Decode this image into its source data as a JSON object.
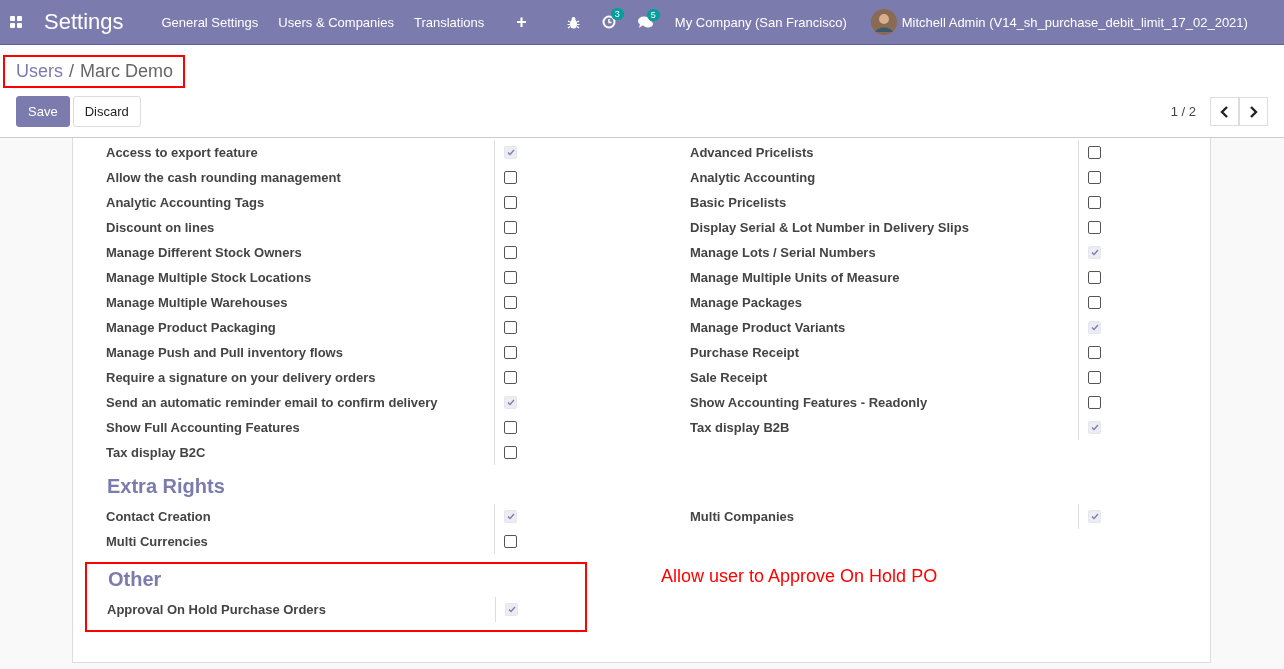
{
  "navbar": {
    "app_title": "Settings",
    "menu": [
      "General Settings",
      "Users & Companies",
      "Translations"
    ],
    "plus": "+",
    "activity_badge": "3",
    "message_badge": "5",
    "company": "My Company (San Francisco)",
    "user": "Mitchell Admin (V14_sh_purchase_debit_limit_17_02_2021)"
  },
  "breadcrumb": {
    "parent": "Users",
    "separator": "/",
    "current": "Marc Demo"
  },
  "buttons": {
    "save": "Save",
    "discard": "Discard"
  },
  "pager": {
    "text": "1 / 2"
  },
  "sections": [
    {
      "fields": [
        {
          "label": "Access to export feature",
          "checked": true
        },
        {
          "label": "Advanced Pricelists",
          "checked": false
        },
        {
          "label": "Allow the cash rounding management",
          "checked": false
        },
        {
          "label": "Analytic Accounting",
          "checked": false
        },
        {
          "label": "Analytic Accounting Tags",
          "checked": false
        },
        {
          "label": "Basic Pricelists",
          "checked": false
        },
        {
          "label": "Discount on lines",
          "checked": false
        },
        {
          "label": "Display Serial & Lot Number in Delivery Slips",
          "checked": false
        },
        {
          "label": "Manage Different Stock Owners",
          "checked": false
        },
        {
          "label": "Manage Lots / Serial Numbers",
          "checked": true
        },
        {
          "label": "Manage Multiple Stock Locations",
          "checked": false
        },
        {
          "label": "Manage Multiple Units of Measure",
          "checked": false
        },
        {
          "label": "Manage Multiple Warehouses",
          "checked": false
        },
        {
          "label": "Manage Packages",
          "checked": false
        },
        {
          "label": "Manage Product Packaging",
          "checked": false
        },
        {
          "label": "Manage Product Variants",
          "checked": true
        },
        {
          "label": "Manage Push and Pull inventory flows",
          "checked": false
        },
        {
          "label": "Purchase Receipt",
          "checked": false
        },
        {
          "label": "Require a signature on your delivery orders",
          "checked": false
        },
        {
          "label": "Sale Receipt",
          "checked": false
        },
        {
          "label": "Send an automatic reminder email to confirm delivery",
          "checked": true
        },
        {
          "label": "Show Accounting Features - Readonly",
          "checked": false
        },
        {
          "label": "Show Full Accounting Features",
          "checked": false
        },
        {
          "label": "Tax display B2B",
          "checked": true
        },
        {
          "label": "Tax display B2C",
          "checked": false
        }
      ]
    },
    {
      "title": "Extra Rights",
      "fields": [
        {
          "label": "Contact Creation",
          "checked": true
        },
        {
          "label": "Multi Companies",
          "checked": true
        },
        {
          "label": "Multi Currencies",
          "checked": false
        }
      ]
    }
  ],
  "other": {
    "title": "Other",
    "highlighted": true,
    "fields": [
      {
        "label": "Approval On Hold Purchase Orders",
        "checked": true
      }
    ],
    "annotation": "Allow user to Approve On Hold PO"
  }
}
